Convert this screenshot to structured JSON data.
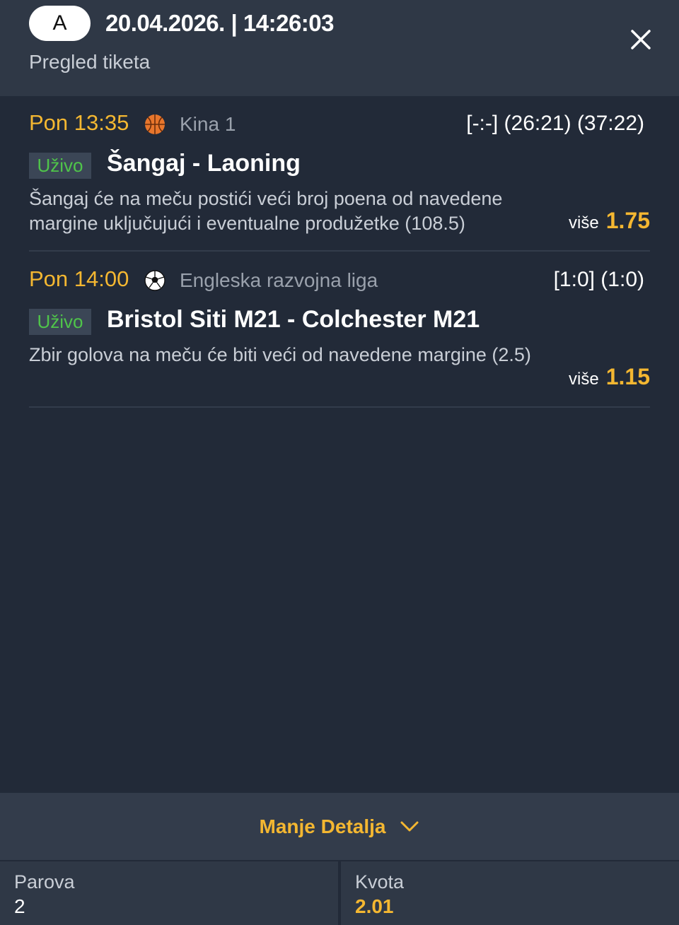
{
  "header": {
    "badge": "A",
    "datetime": "20.04.2026. | 14:26:03",
    "subtitle": "Pregled tiketa",
    "close_icon": "close-icon"
  },
  "bets": [
    {
      "time": "Pon 13:35",
      "sport_icon": "basketball-icon",
      "league": "Kina 1",
      "score": "[-:-] (26:21) (37:22)",
      "live_label": "Uživo",
      "match": "Šangaj - Laoning",
      "description": "Šangaj će na meču postići veći broj poena od navedene margine uključujući i eventualne produžetke (108.5)",
      "odd_label": "više",
      "odd_value": "1.75"
    },
    {
      "time": "Pon 14:00",
      "sport_icon": "soccer-ball-icon",
      "league": "Engleska razvojna liga",
      "score": "[1:0] (1:0)",
      "live_label": "Uživo",
      "match": "Bristol Siti M21 - Colchester M21",
      "description": "Zbir golova na meču će biti veći od navedene margine (2.5)",
      "odd_label": "više",
      "odd_value": "1.15"
    }
  ],
  "details_toggle": {
    "label": "Manje Detalja",
    "icon": "chevron-down-icon"
  },
  "footer": {
    "pairs_label": "Parova",
    "pairs_value": "2",
    "odds_label": "Kvota",
    "odds_value": "2.01"
  },
  "colors": {
    "accent": "#f4b731",
    "live": "#4fc44a",
    "background": "#222a38",
    "header": "#2f3846"
  }
}
